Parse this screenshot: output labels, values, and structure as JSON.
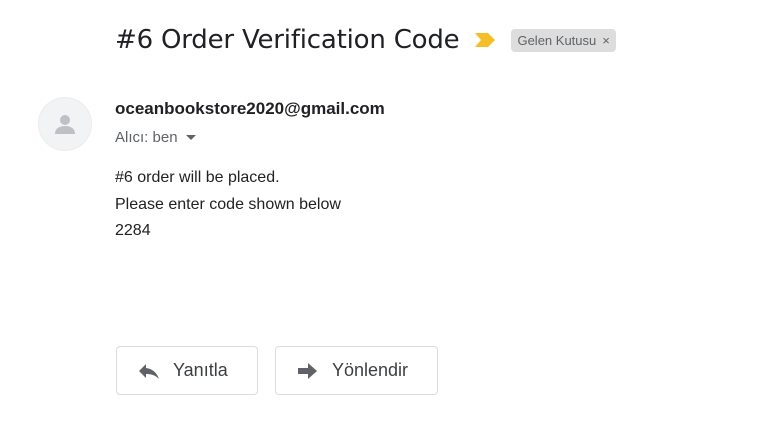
{
  "email": {
    "subject": "#6 Order Verification Code",
    "label": "Gelen Kutusu",
    "label_close": "×",
    "importance_icon": "importance-marker-icon",
    "importance_color": "#f6bf26",
    "sender": "oceanbookstore2020@gmail.com",
    "recipient": "Alıcı: ben",
    "body": {
      "line1": "#6 order will be placed.",
      "line2": "Please enter code shown below",
      "line3": "2284"
    }
  },
  "actions": {
    "reply_label": "Yanıtla",
    "reply_icon": "reply-arrow-icon",
    "forward_label": "Yönlendir",
    "forward_icon": "forward-arrow-icon"
  }
}
